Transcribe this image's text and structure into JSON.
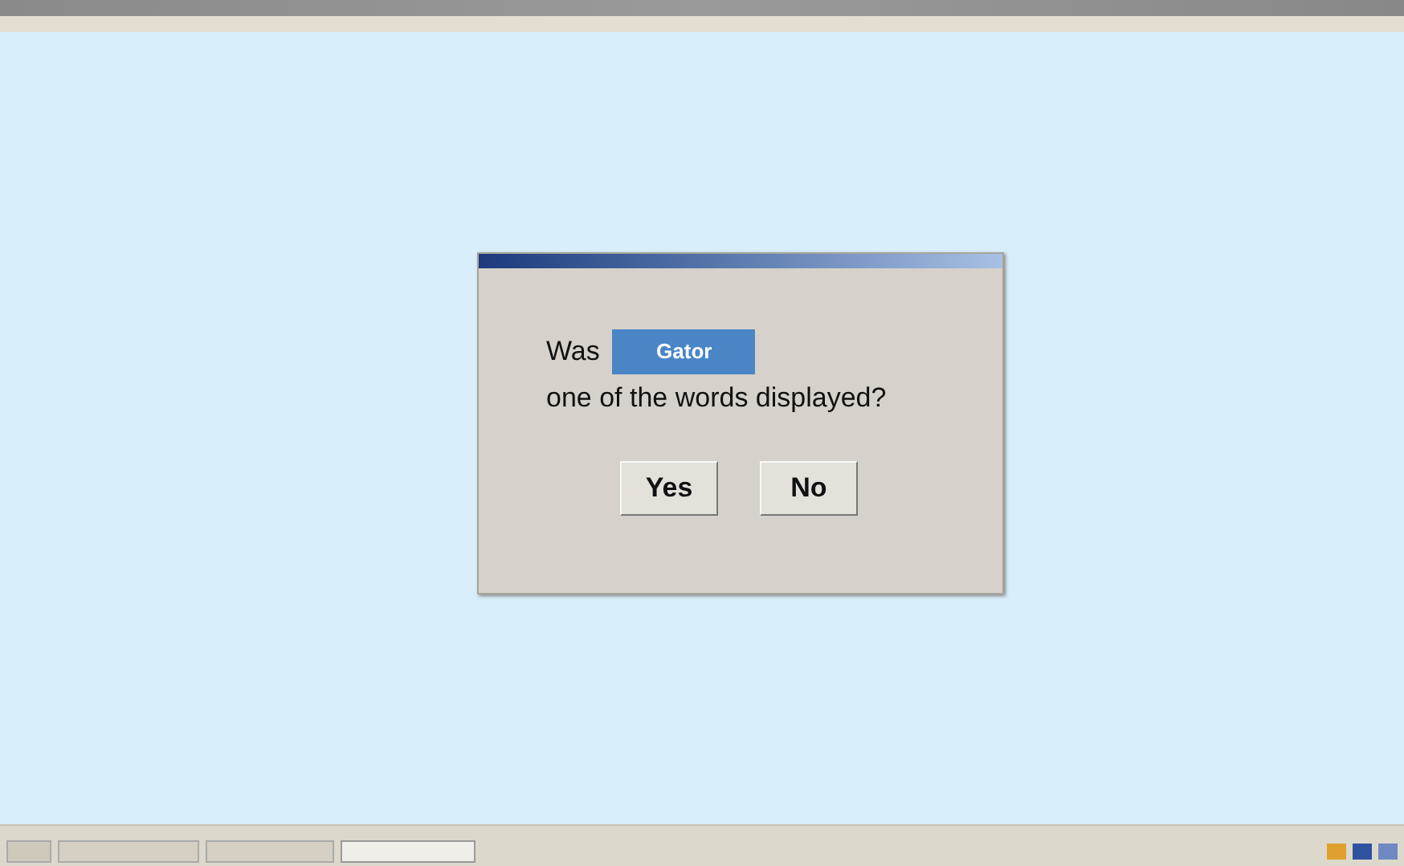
{
  "dialog": {
    "prompt_before": "Was",
    "word": "Gator",
    "prompt_after": "one of the words displayed?",
    "buttons": [
      "Yes",
      "No"
    ]
  }
}
